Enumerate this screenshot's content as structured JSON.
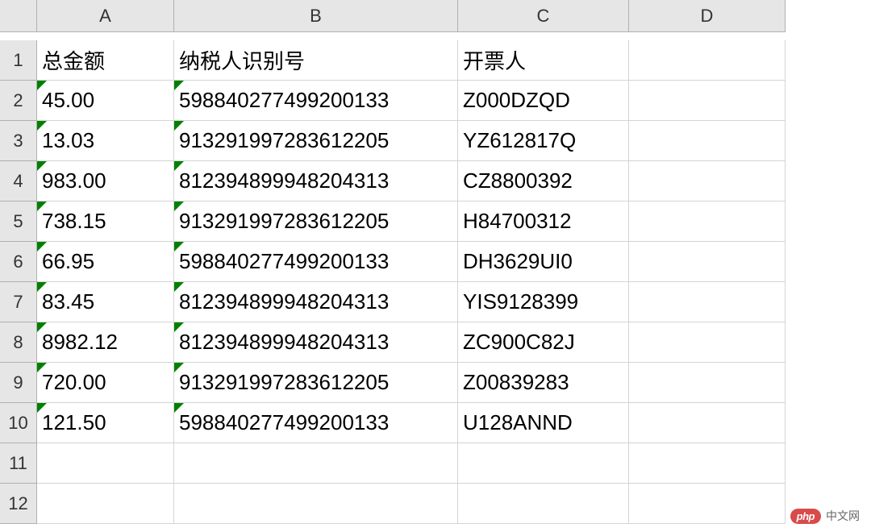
{
  "columns": [
    "A",
    "B",
    "C",
    "D"
  ],
  "row_count": 12,
  "headers": {
    "A": "总金额",
    "B": "纳税人识别号",
    "C": "开票人"
  },
  "rows": [
    {
      "A": "45.00",
      "B": "598840277499200133",
      "C": "Z000DZQD"
    },
    {
      "A": "13.03",
      "B": "913291997283612205",
      "C": "YZ612817Q"
    },
    {
      "A": "983.00",
      "B": "812394899948204313",
      "C": "CZ8800392"
    },
    {
      "A": "738.15",
      "B": "913291997283612205",
      "C": "H84700312"
    },
    {
      "A": "66.95",
      "B": "598840277499200133",
      "C": "DH3629UI0"
    },
    {
      "A": "83.45",
      "B": "812394899948204313",
      "C": "YIS9128399"
    },
    {
      "A": "8982.12",
      "B": "812394899948204313",
      "C": "ZC900C82J"
    },
    {
      "A": "720.00",
      "B": "913291997283612205",
      "C": "Z00839283"
    },
    {
      "A": "121.50",
      "B": "598840277499200133",
      "C": "U128ANND"
    }
  ],
  "watermark": {
    "badge": "php",
    "text": "中文网"
  },
  "chart_data": {
    "type": "table",
    "title": "",
    "columns": [
      "总金额",
      "纳税人识别号",
      "开票人"
    ],
    "data": [
      [
        "45.00",
        "598840277499200133",
        "Z000DZQD"
      ],
      [
        "13.03",
        "913291997283612205",
        "YZ612817Q"
      ],
      [
        "983.00",
        "812394899948204313",
        "CZ8800392"
      ],
      [
        "738.15",
        "913291997283612205",
        "H84700312"
      ],
      [
        "66.95",
        "598840277499200133",
        "DH3629UI0"
      ],
      [
        "83.45",
        "812394899948204313",
        "YIS9128399"
      ],
      [
        "8982.12",
        "812394899948204313",
        "ZC900C82J"
      ],
      [
        "720.00",
        "913291997283612205",
        "Z00839283"
      ],
      [
        "121.50",
        "598840277499200133",
        "U128ANND"
      ]
    ]
  }
}
